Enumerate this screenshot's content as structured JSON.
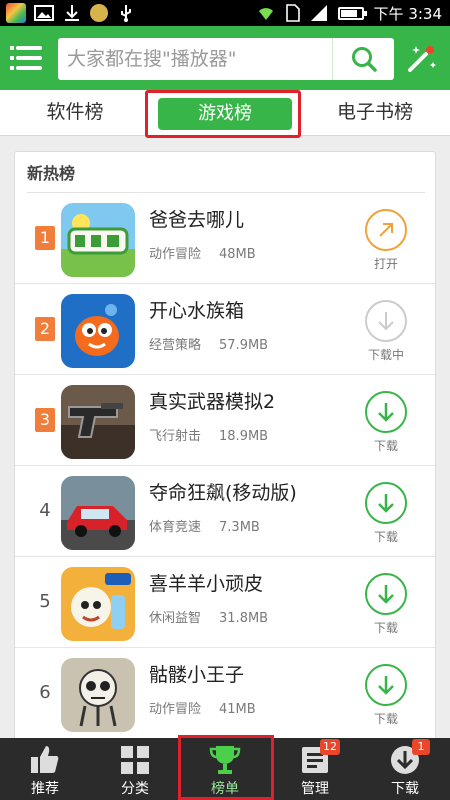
{
  "status_bar": {
    "time": "下午 3:34",
    "battery_level": 0.75
  },
  "header": {
    "search_placeholder": "大家都在搜\"播放器\"",
    "search_button": "search-icon",
    "menu_icon": "menu-icon",
    "tool_icon": "magic-wand-icon"
  },
  "tabs": [
    {
      "label": "软件榜",
      "selected": false
    },
    {
      "label": "游戏榜",
      "selected": true
    },
    {
      "label": "电子书榜",
      "selected": false
    }
  ],
  "list": {
    "title": "新热榜",
    "items": [
      {
        "rank": "1",
        "name": "爸爸去哪儿",
        "category": "动作冒险",
        "size": "48MB",
        "action": "打开",
        "action_icon": "open-arrow-icon"
      },
      {
        "rank": "2",
        "name": "开心水族箱",
        "category": "经营策略",
        "size": "57.9MB",
        "action": "下载中",
        "action_icon": "download-icon"
      },
      {
        "rank": "3",
        "name": "真实武器模拟2",
        "category": "飞行射击",
        "size": "18.9MB",
        "action": "下载",
        "action_icon": "download-icon"
      },
      {
        "rank": "4",
        "name": "夺命狂飙(移动版)",
        "category": "体育竞速",
        "size": "7.3MB",
        "action": "下载",
        "action_icon": "download-icon"
      },
      {
        "rank": "5",
        "name": "喜羊羊小顽皮",
        "category": "休闲益智",
        "size": "31.8MB",
        "action": "下载",
        "action_icon": "download-icon"
      },
      {
        "rank": "6",
        "name": "骷髅小王子",
        "category": "动作冒险",
        "size": "41MB",
        "action": "下载",
        "action_icon": "download-icon"
      }
    ]
  },
  "bottom_nav": [
    {
      "label": "推荐",
      "icon": "thumbs-up-icon",
      "active": false
    },
    {
      "label": "分类",
      "icon": "grid-icon",
      "active": false
    },
    {
      "label": "榜单",
      "icon": "trophy-icon",
      "active": true
    },
    {
      "label": "管理",
      "icon": "manage-icon",
      "active": false,
      "badge": "12"
    },
    {
      "label": "下载",
      "icon": "download-icon",
      "active": false,
      "badge": "1"
    }
  ],
  "colors": {
    "brand_green": "#38b549",
    "hot_rank_orange": "#f07d3a",
    "open_orange": "#f0a23a",
    "downloading_gray": "#cccccc",
    "highlight_red": "#e0202a"
  }
}
